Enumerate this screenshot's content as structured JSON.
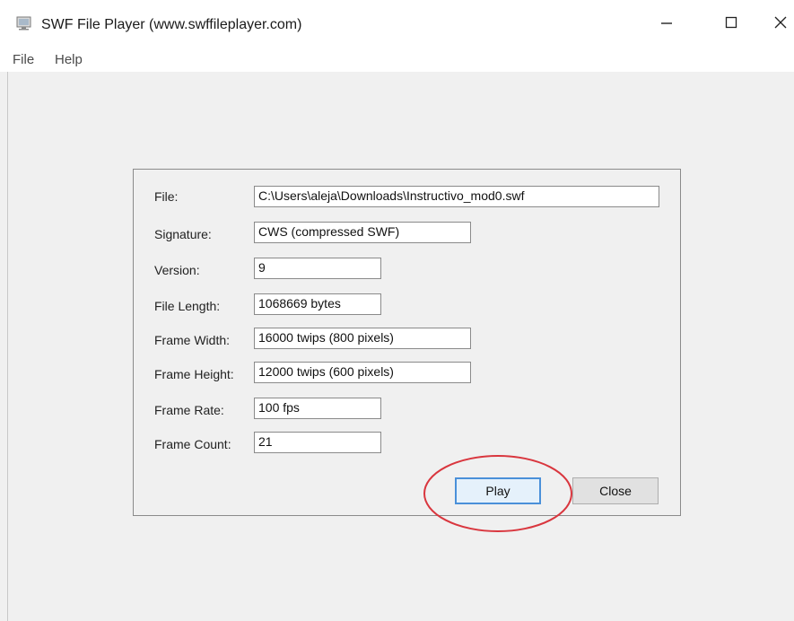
{
  "window": {
    "title": "SWF File Player (www.swffileplayer.com)",
    "icon": "swf-player-app-icon",
    "controls": {
      "minimize_icon": "minimize-icon",
      "maximize_icon": "maximize-icon",
      "close_icon": "close-icon"
    }
  },
  "menubar": {
    "items": [
      {
        "label": "File"
      },
      {
        "label": "Help"
      }
    ]
  },
  "details": {
    "fields": [
      {
        "label": "File:",
        "value": "C:\\Users\\aleja\\Downloads\\Instructivo_mod0.swf"
      },
      {
        "label": "Signature:",
        "value": "CWS (compressed SWF)"
      },
      {
        "label": "Version:",
        "value": "9"
      },
      {
        "label": "File Length:",
        "value": "1068669 bytes"
      },
      {
        "label": "Frame Width:",
        "value": "16000 twips (800 pixels)"
      },
      {
        "label": "Frame Height:",
        "value": "12000 twips (600 pixels)"
      },
      {
        "label": "Frame Rate:",
        "value": "100 fps"
      },
      {
        "label": "Frame Count:",
        "value": "21"
      }
    ]
  },
  "buttons": {
    "play": "Play",
    "close": "Close"
  },
  "colors": {
    "highlight_circle": "#d9363e",
    "play_border": "#4a90d9"
  }
}
